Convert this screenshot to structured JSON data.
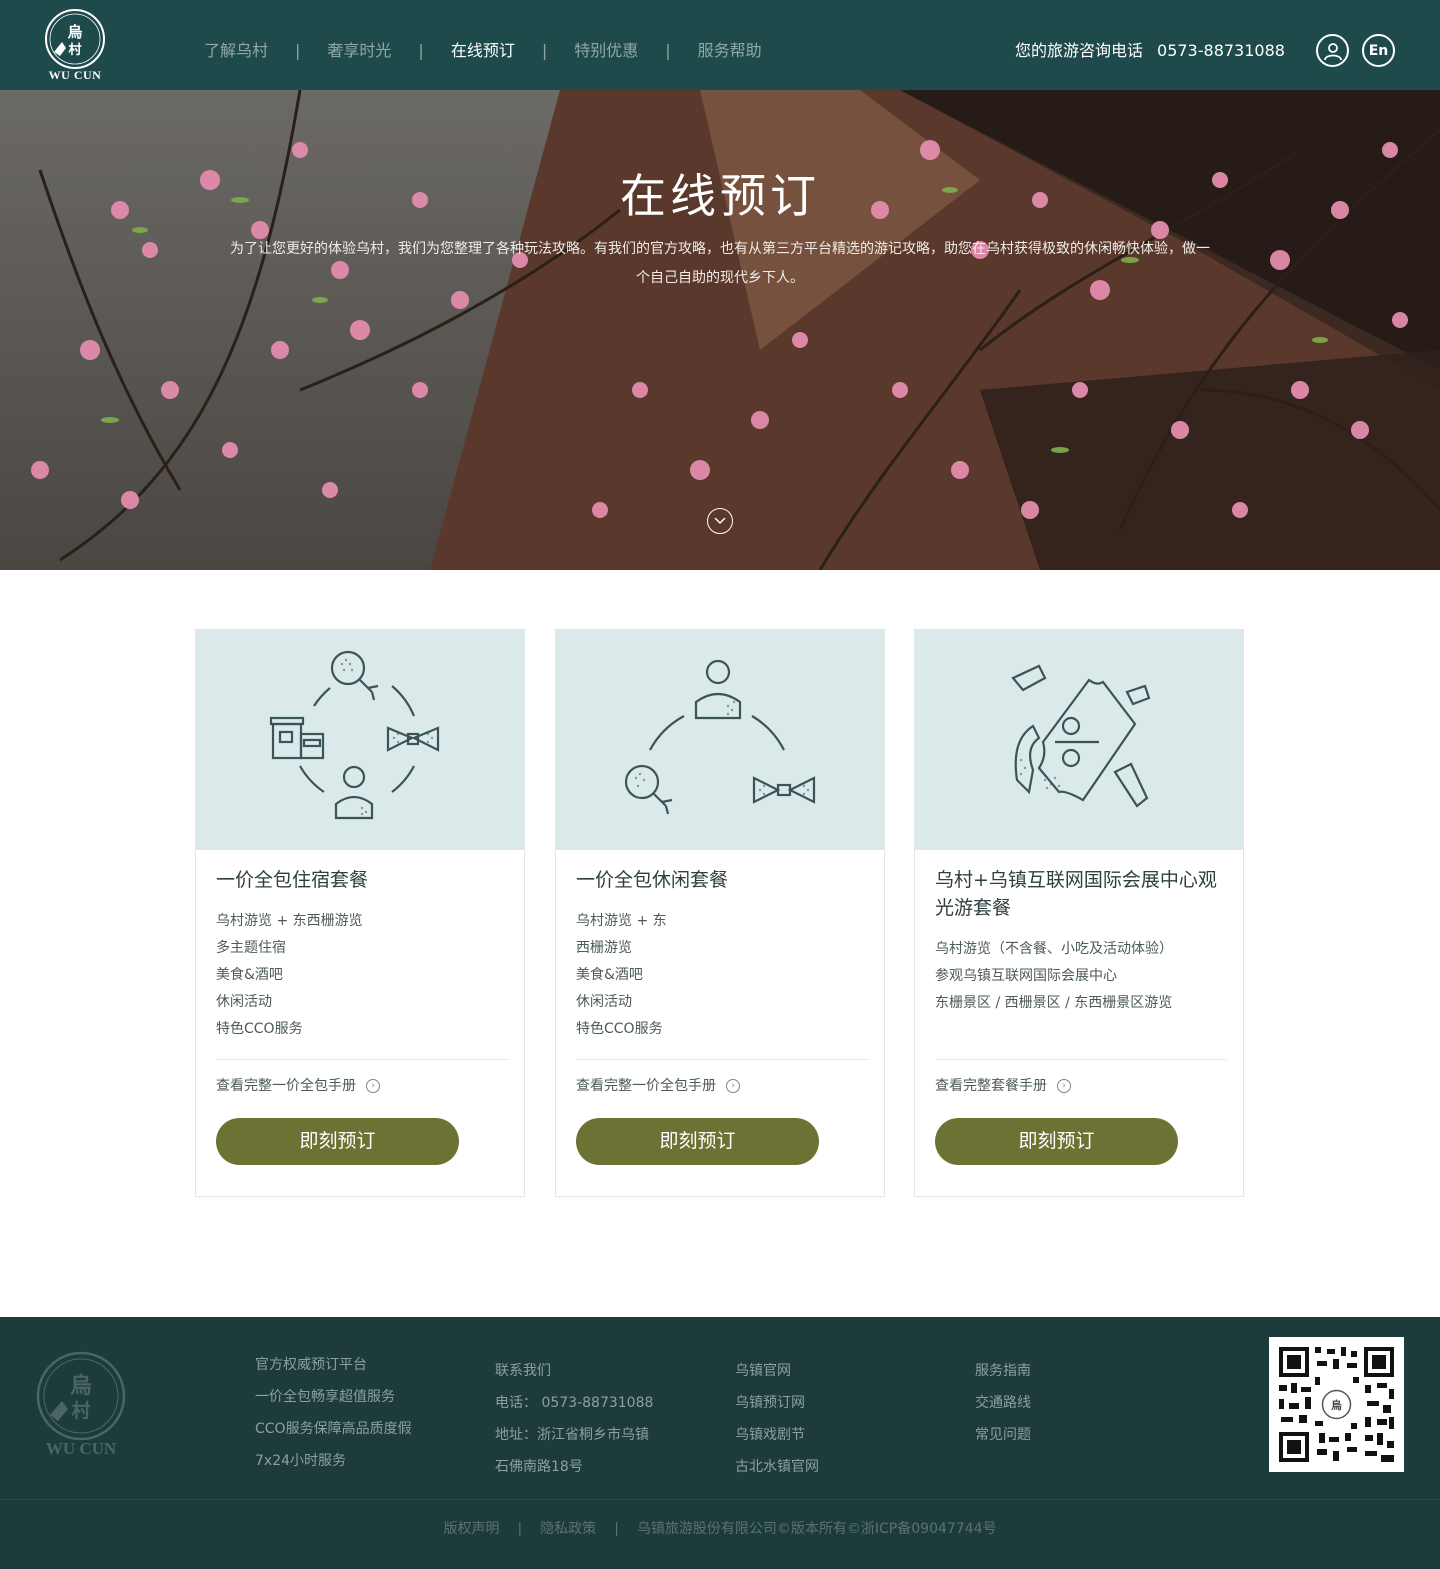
{
  "brand": {
    "logo_text": "WU CUN",
    "logo_glyphs": "烏村"
  },
  "nav": {
    "items": [
      {
        "label": "了解乌村",
        "active": false
      },
      {
        "label": "奢享时光",
        "active": false
      },
      {
        "label": "在线预订",
        "active": true
      },
      {
        "label": "特别优惠",
        "active": false
      },
      {
        "label": "服务帮助",
        "active": false
      }
    ],
    "separator": "|"
  },
  "header": {
    "phone_label": "您的旅游咨询电话",
    "phone_number": "0573-88731088",
    "user_icon": "user-icon",
    "lang_label": "En"
  },
  "hero": {
    "title": "在线预订",
    "description": "为了让您更好的体验乌村，我们为您整理了各种玩法攻略。有我们的官方攻略，也有从第三方平台精选的游记攻略，助您在乌村获得极致的休闲畅快体验，做一个自己自助的现代乡下人。",
    "scroll_icon": "chevron-down-icon"
  },
  "cards": [
    {
      "icon": "package-cycle-icon",
      "title": "一价全包住宿套餐",
      "items": [
        "乌村游览 + 东西栅游览",
        "多主题住宿",
        "美食&酒吧",
        "休闲活动",
        "特色CCO服务"
      ],
      "link": "查看完整一价全包手册",
      "button": "即刻预订"
    },
    {
      "icon": "leisure-cycle-icon",
      "title": "一价全包休闲套餐",
      "items": [
        "乌村游览 + 东",
        "西栅游览",
        "美食&酒吧",
        "休闲活动",
        "特色CCO服务"
      ],
      "link": "查看完整一价全包手册",
      "button": "即刻预订"
    },
    {
      "icon": "ticket-icon",
      "title": "乌村+乌镇互联网国际会展中心观光游套餐",
      "items": [
        "乌村游览（不含餐、小吃及活动体验）",
        "参观乌镇互联网国际会展中心",
        "东栅景区 / 西栅景区 / 东西栅景区游览"
      ],
      "link": "查看完整套餐手册",
      "button": "即刻预订"
    }
  ],
  "footer": {
    "logo_text": "WU CUN",
    "col1": [
      "官方权威预订平台",
      "一价全包畅享超值服务",
      "CCO服务保障高品质度假",
      "7x24小时服务"
    ],
    "col2": [
      "联系我们",
      "电话： 0573-88731088",
      "地址：浙江省桐乡市乌镇",
      "石佛南路18号"
    ],
    "col3": [
      "乌镇官网",
      "乌镇预订网",
      "乌镇戏剧节",
      "古北水镇官网"
    ],
    "col4": [
      "服务指南",
      "交通路线",
      "常见问题"
    ],
    "qr_icon": "qr-code-icon",
    "bottom": {
      "copyright_link": "版权声明",
      "privacy_link": "隐私政策",
      "company": "乌镇旅游股份有限公司©版本所有©浙ICP备09047744号"
    }
  },
  "colors": {
    "header_bg": "#1f4a4c",
    "card_img_bg": "#dbe9ea",
    "button": "#6b7233",
    "footer_bg": "#1e3b3c",
    "icon_stroke": "#3b5556"
  }
}
